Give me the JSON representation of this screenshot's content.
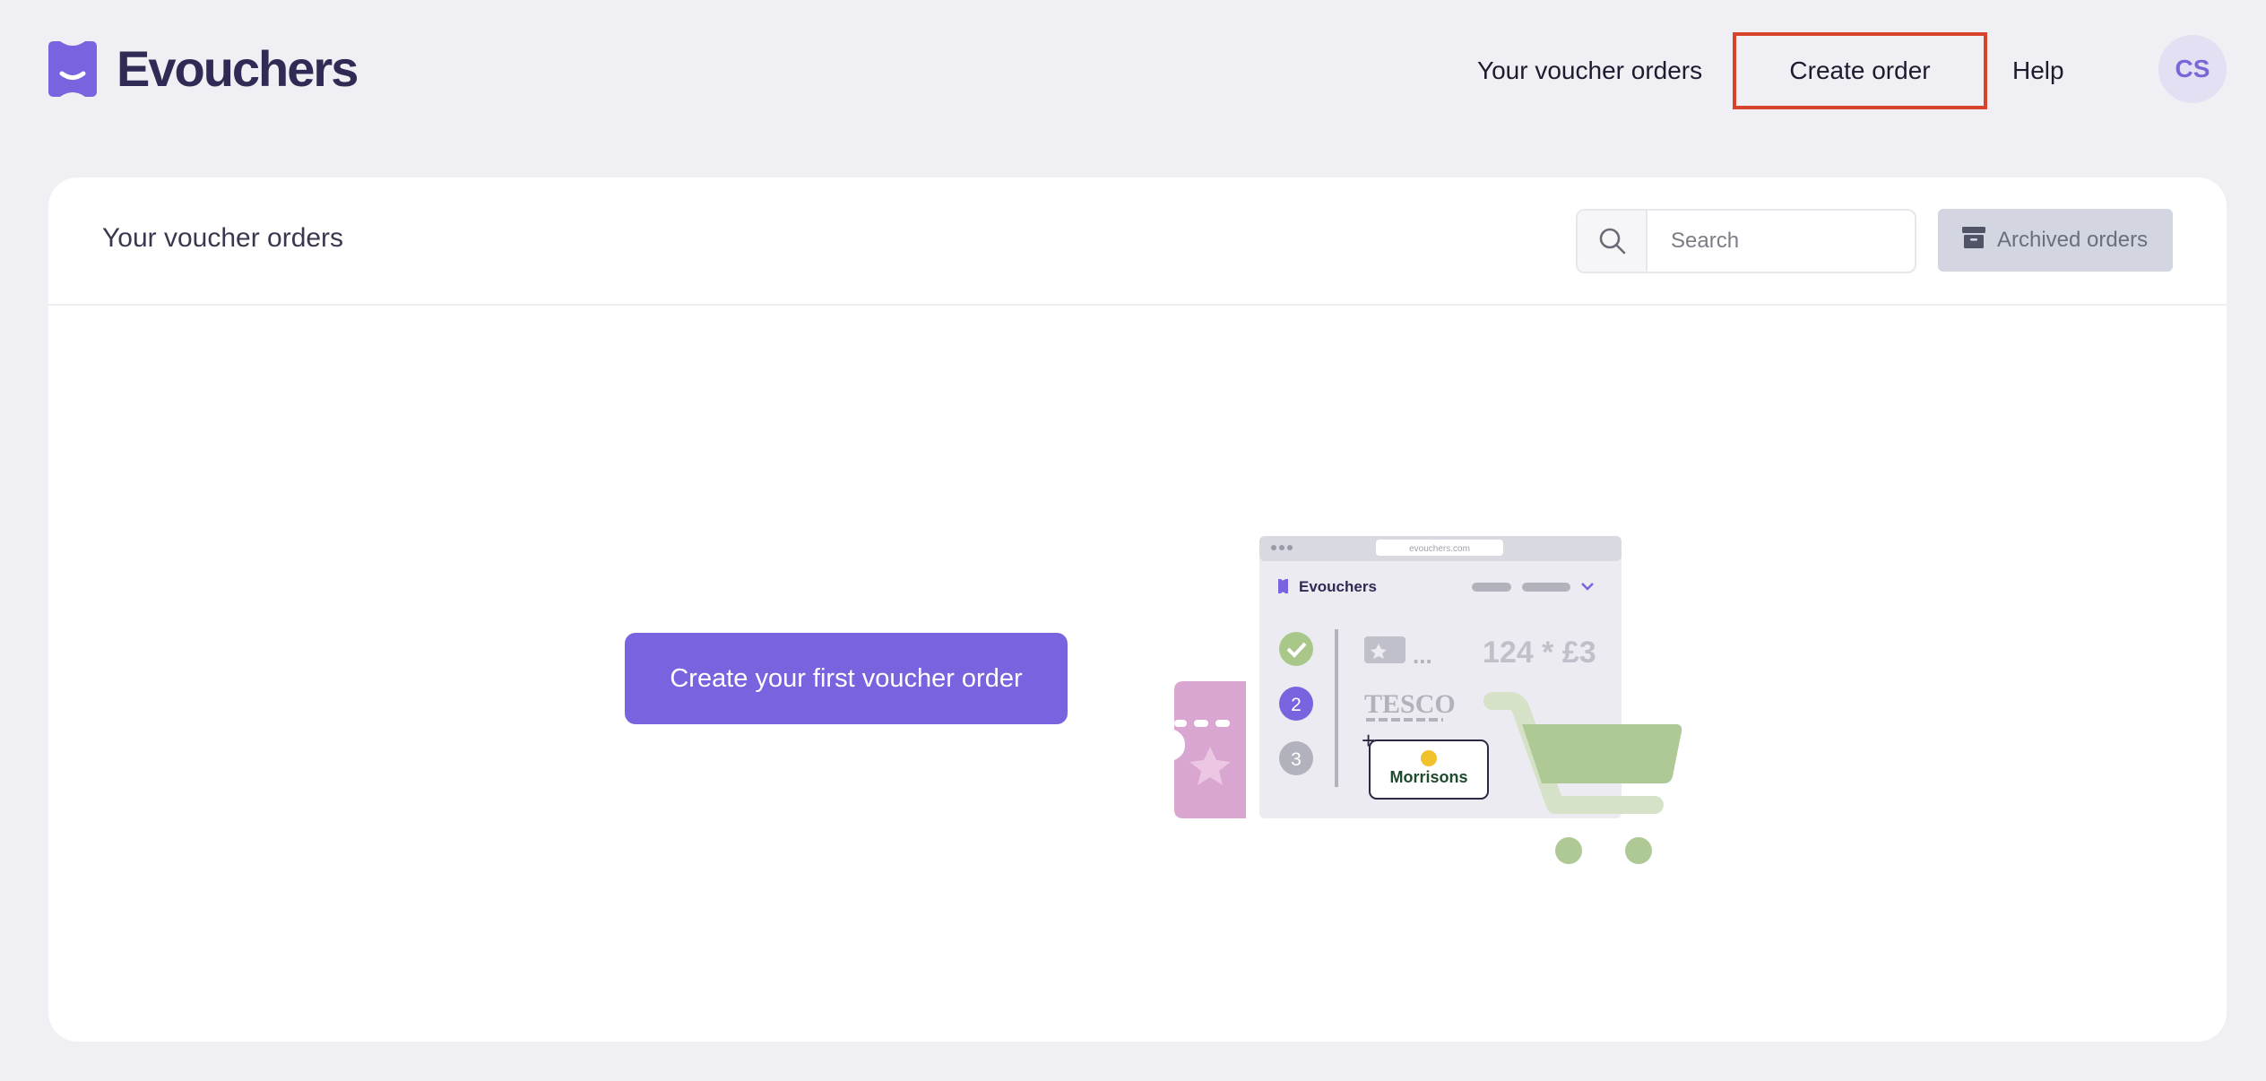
{
  "brand": {
    "name": "Evouchers",
    "logo_icon": "evouchers-logo-icon",
    "color": "#7a63de"
  },
  "nav": {
    "orders_label": "Your voucher orders",
    "create_label": "Create order",
    "help_label": "Help",
    "avatar_initials": "CS"
  },
  "card": {
    "title": "Your voucher orders",
    "search": {
      "placeholder": "Search",
      "value": ""
    },
    "archived_label": "Archived orders"
  },
  "empty_state": {
    "cta_label": "Create your first voucher order",
    "illustration": {
      "url_text": "evouchers.com",
      "brand_text": "Evouchers",
      "step_two": "2",
      "step_three": "3",
      "quantity_text": "124 * £3",
      "ellipsis": "...",
      "retailer_1": "TESCO",
      "retailer_2": "Morrisons"
    }
  },
  "colors": {
    "highlight_border": "#d9432c",
    "background": "#efeff4",
    "accent": "#7a63de",
    "cart_green": "#afc996"
  }
}
